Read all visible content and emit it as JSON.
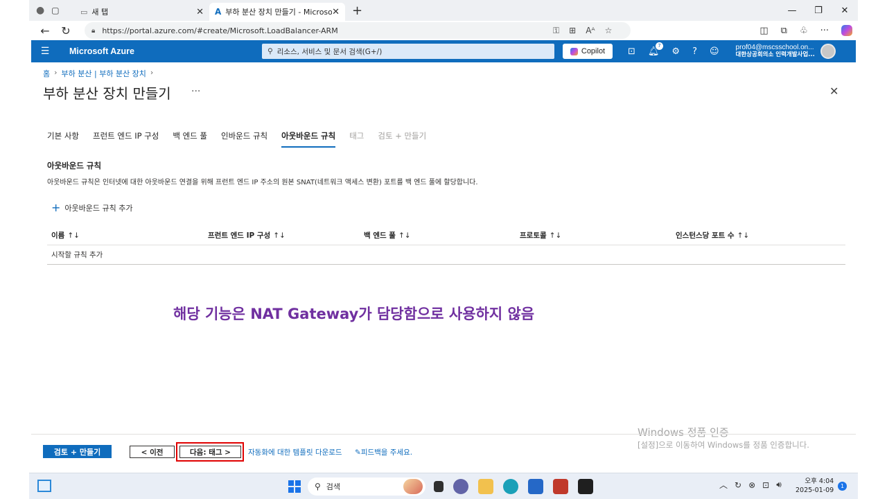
{
  "browser": {
    "tabs": [
      {
        "label": "새 탭"
      },
      {
        "label": "부하 분산 장치 만들기 - Microsof"
      }
    ],
    "url": "https://portal.azure.com/#create/Microsoft.LoadBalancer-ARM"
  },
  "azure_header": {
    "brand": "Microsoft Azure",
    "search_placeholder": "리소스, 서비스 및 문서 검색(G+/)",
    "copilot_label": "Copilot",
    "notification_count": "7",
    "user_email": "prof04@mscsschool.on...",
    "user_org": "대한상공회의소 인력개발사업..."
  },
  "breadcrumb": [
    "홈",
    "부하 분산 | 부하 분산 장치"
  ],
  "page_title": "부하 분산 장치 만들기",
  "wizard_tabs": [
    {
      "label": "기본 사항",
      "state": "normal"
    },
    {
      "label": "프런트 엔드 IP 구성",
      "state": "normal"
    },
    {
      "label": "백 엔드 풀",
      "state": "normal"
    },
    {
      "label": "인바운드 규칙",
      "state": "normal"
    },
    {
      "label": "아웃바운드 규칙",
      "state": "selected"
    },
    {
      "label": "태그",
      "state": "disabled"
    },
    {
      "label": "검토 + 만들기",
      "state": "disabled"
    }
  ],
  "section": {
    "title": "아웃바운드 규칙",
    "description": "아웃바운드 규칙은 인터넷에 대한 아웃바운드 연결을 위해 프런트 엔드 IP 주소의 원본 SNAT(네트워크 액세스 변환) 포트를 백 엔드 풀에 할당합니다.",
    "add_rule_label": "아웃바운드 규칙 추가"
  },
  "table": {
    "columns": [
      "이름",
      "프런트 엔드 IP 구성",
      "백 엔드 풀",
      "프로토콜",
      "인스턴스당 포트 수"
    ],
    "empty_text": "시작할 규칙 추가"
  },
  "annotation": "해당 기능은 NAT Gateway가 담당함으로 사용하지 않음",
  "watermark": {
    "line1": "Windows 정품 인증",
    "line2": "[설정]으로 이동하여 Windows를 정품 인증합니다."
  },
  "footer": {
    "review_create": "검토 + 만들기",
    "previous": "< 이전",
    "next": "다음: 태그 >",
    "template_link": "자동화에 대한 템플릿 다운로드",
    "feedback_link": "피드백을 주세요."
  },
  "taskbar": {
    "search_label": "검색",
    "time": "오후 4:04",
    "date": "2025-01-09",
    "notif_count": "1"
  },
  "colors": {
    "azure_blue": "#0f6cbd",
    "annotation_purple": "#7030a0",
    "highlight_red": "#e00000"
  }
}
